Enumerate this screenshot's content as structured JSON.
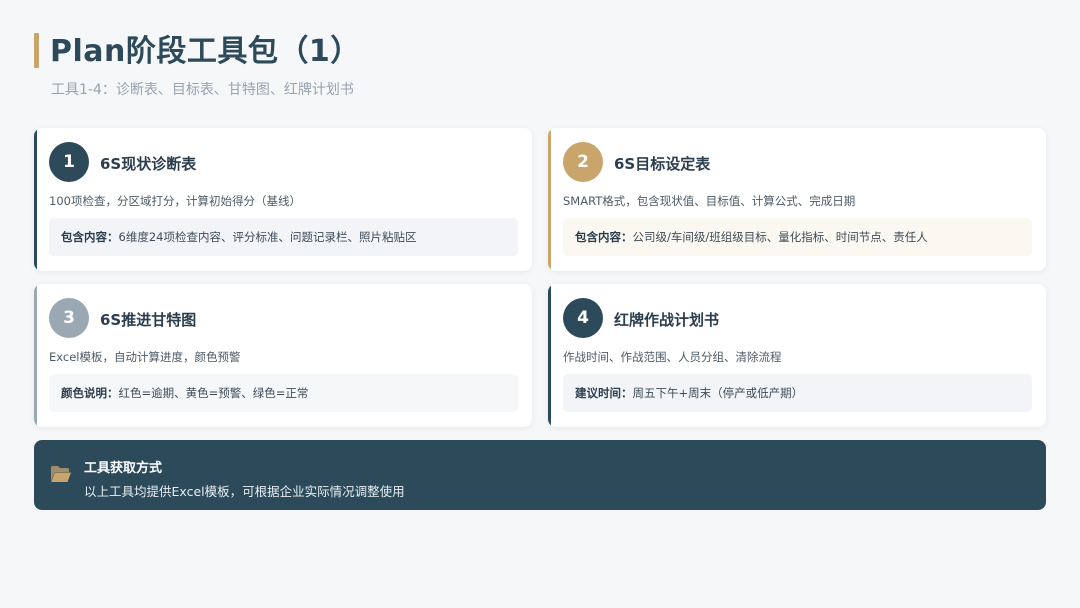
{
  "header": {
    "title": "Plan阶段工具包（1）",
    "subtitle": "工具1-4：诊断表、目标表、甘特图、红牌计划书"
  },
  "cards": [
    {
      "number": "1",
      "title": "6S现状诊断表",
      "description": "100项检查，分区域打分，计算初始得分（基线）",
      "detail_label": "包含内容：",
      "detail_text": "6维度24项检查内容、评分标准、问题记录栏、照片粘贴区",
      "accent_color": "#2c4a5a",
      "circle_color": "#2c4a5a",
      "box_color": "#f2f4f7"
    },
    {
      "number": "2",
      "title": "6S目标设定表",
      "description": "SMART格式，包含现状值、目标值、计算公式、完成日期",
      "detail_label": "包含内容：",
      "detail_text": "公司级/车间级/班组级目标、量化指标、时间节点、责任人",
      "accent_color": "#c9a46b",
      "circle_color": "#c9a46b",
      "box_color": "#fbf8f2"
    },
    {
      "number": "3",
      "title": "6S推进甘特图",
      "description": "Excel模板，自动计算进度，颜色预警",
      "detail_label": "颜色说明：",
      "detail_text": "红色=逾期、黄色=预警、绿色=正常",
      "accent_color": "#9aa8b4",
      "circle_color": "#9aa8b4",
      "box_color": "#f6f7f9"
    },
    {
      "number": "4",
      "title": "红牌作战计划书",
      "description": "作战时间、作战范围、人员分组、清除流程",
      "detail_label": "建议时间：",
      "detail_text": "周五下午+周末（停产或低产期）",
      "accent_color": "#2c4a5a",
      "circle_color": "#2c4a5a",
      "box_color": "#f2f4f7"
    }
  ],
  "footer": {
    "icon": "folder-open-icon",
    "title": "工具获取方式",
    "text": "以上工具均提供Excel模板，可根据企业实际情况调整使用",
    "icon_color": "#c9a46b"
  }
}
